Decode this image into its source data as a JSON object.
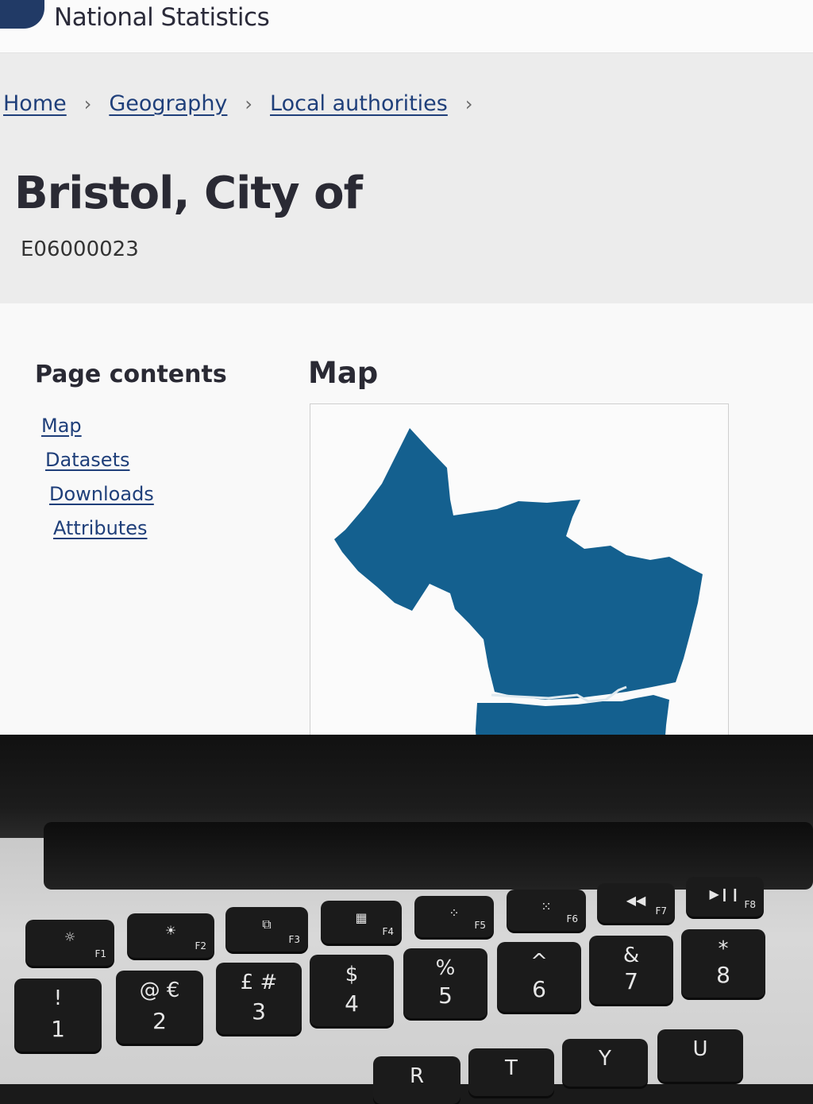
{
  "header": {
    "site_name": "National Statistics"
  },
  "breadcrumb": [
    {
      "label": "Home"
    },
    {
      "label": "Geography"
    },
    {
      "label": "Local authorities"
    }
  ],
  "page": {
    "title": "Bristol, City of",
    "code": "E06000023"
  },
  "toc": {
    "title": "Page contents",
    "items": [
      {
        "label": "Map"
      },
      {
        "label": "Datasets"
      },
      {
        "label": "Downloads"
      },
      {
        "label": "Attributes"
      }
    ]
  },
  "map": {
    "title": "Map",
    "fill_color": "#14608f",
    "river_color": "#dfe9ef"
  },
  "keyboard": {
    "function_keys": [
      {
        "label": "F1",
        "icon": "brightness-down-icon",
        "glyph": "☼"
      },
      {
        "label": "F2",
        "icon": "brightness-up-icon",
        "glyph": "☀"
      },
      {
        "label": "F3",
        "icon": "mission-control-icon",
        "glyph": "⧉"
      },
      {
        "label": "F4",
        "icon": "launchpad-icon",
        "glyph": "▦"
      },
      {
        "label": "F5",
        "icon": "keyboard-light-down-icon",
        "glyph": "⁘"
      },
      {
        "label": "F6",
        "icon": "keyboard-light-up-icon",
        "glyph": "⁙"
      },
      {
        "label": "F7",
        "icon": "rewind-icon",
        "glyph": "◀◀"
      },
      {
        "label": "F8",
        "icon": "play-pause-icon",
        "glyph": "▶❙❙"
      }
    ],
    "number_keys": [
      {
        "top": "!",
        "bottom": "1"
      },
      {
        "top": "@ €",
        "bottom": "2"
      },
      {
        "top": "£ #",
        "bottom": "3"
      },
      {
        "top": "$",
        "bottom": "4"
      },
      {
        "top": "%",
        "bottom": "5"
      },
      {
        "top": "^",
        "bottom": "6"
      },
      {
        "top": "&",
        "bottom": "7"
      },
      {
        "top": "*",
        "bottom": "8"
      }
    ],
    "letter_keys": [
      "R",
      "T",
      "Y",
      "U"
    ]
  }
}
